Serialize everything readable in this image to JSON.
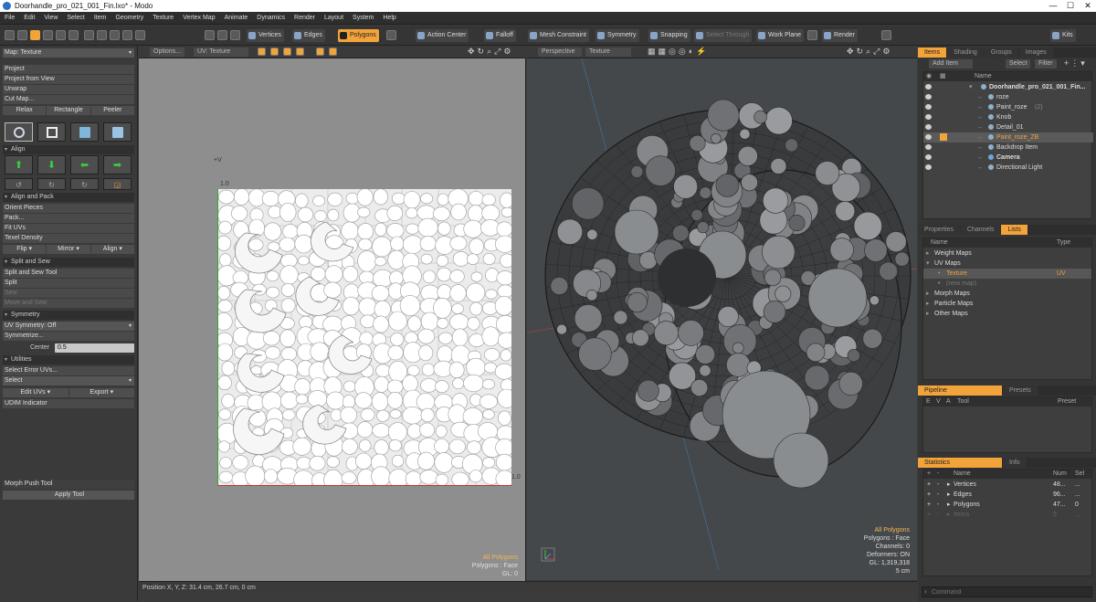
{
  "window": {
    "title": "Doorhandle_pro_021_001_Fin.lxo* - Modo",
    "min": "—",
    "max": "☐",
    "close": "✕"
  },
  "menu": [
    "File",
    "Edit",
    "View",
    "Select",
    "Item",
    "Geometry",
    "Texture",
    "Vertex Map",
    "Animate",
    "Dynamics",
    "Render",
    "Layout",
    "System",
    "Help"
  ],
  "toolbar": {
    "vertices": "Vertices",
    "edges": "Edges",
    "polygons": "Polygons",
    "action_center": "Action Center",
    "falloff": "Falloff",
    "mesh_constraint": "Mesh Constraint",
    "symmetry": "Symmetry",
    "snapping": "Snapping",
    "select_through": "Select Through",
    "work_plane": "Work Plane",
    "render": "Render",
    "kits": "Kits"
  },
  "left": {
    "map_select": "Map: Texture",
    "project": "Project",
    "project_from_view": "Project from View",
    "unwrap": "Unwrap",
    "cut_map": "Cut Map...",
    "relax": "Relax",
    "rectangle": "Rectangle",
    "peeler": "Peeler",
    "align": "Align",
    "align_and_pack": "Align and Pack",
    "orient_pieces": "Orient Pieces",
    "pack": "Pack...",
    "fit_uvs": "Fit UVs",
    "texel_density": "Texel Density",
    "flip": "Flip",
    "mirror": "Mirror",
    "align_btn": "Align",
    "split_and_sew": "Split and Sew",
    "split_and_sew_tool": "Split and Sew Tool",
    "split": "Split",
    "sew": "Sew",
    "move_and_sew": "Move and Sew",
    "symmetry": "Symmetry",
    "uv_symmetry": "UV Symmetry: Off",
    "symmetrize": "Symmetrize...",
    "center_label": "Center",
    "center_value": "0.5",
    "utilities": "Utilities",
    "select_error_uvs": "Select Error UVs...",
    "select": "Select",
    "edit_uvs": "Edit UVs",
    "export": "Export",
    "udim_indicator": "UDIM Indicator",
    "morph_push_tool": "Morph Push Tool",
    "apply_tool": "Apply Tool"
  },
  "uv": {
    "options": "Options...",
    "view_label": "UV: Texture",
    "plus_v": "+V",
    "tick_top": "1.0",
    "tick_right": "1.0",
    "info1": "All Polygons",
    "info2": "Polygons : Face",
    "info3": "GL: 0"
  },
  "view3d": {
    "perspective": "Perspective",
    "texture": "Texture",
    "info": [
      "All Polygons",
      "Polygons : Face",
      "Channels: 0",
      "Deformers: ON",
      "GL: 1,319,318",
      "5 cm"
    ]
  },
  "status": "Position X, Y, Z:  31.4 cm, 26.7 cm, 0 cm",
  "items_panel": {
    "tabs": [
      "Items",
      "Shading",
      "Groups",
      "Images"
    ],
    "add_item": "Add Item",
    "select": "Select",
    "filter": "Filter",
    "col_name": "Name",
    "rows": [
      {
        "label": "Doorhandle_pro_021_001_Fin...",
        "bold": true,
        "indent": 0
      },
      {
        "label": "roze",
        "indent": 1
      },
      {
        "label": "Paint_roze",
        "suffix": "(2)",
        "indent": 1
      },
      {
        "label": "Knob",
        "indent": 1
      },
      {
        "label": "Detail_01",
        "indent": 1
      },
      {
        "label": "Paint_roze_ZB",
        "indent": 1,
        "selected": true
      },
      {
        "label": "Backdrop Item",
        "indent": 1
      },
      {
        "label": "Camera",
        "indent": 1,
        "bold": true
      },
      {
        "label": "Directional Light",
        "indent": 1
      }
    ]
  },
  "lists_panel": {
    "tabs": [
      "Properties",
      "Channels",
      "Lists"
    ],
    "col_name": "Name",
    "col_type": "Type",
    "rows": [
      {
        "label": "Weight Maps"
      },
      {
        "label": "UV Maps",
        "open": true
      },
      {
        "label": "Texture",
        "type": "UV",
        "selected": true
      },
      {
        "label": "(new map)",
        "dim": true
      },
      {
        "label": "Morph Maps"
      },
      {
        "label": "Particle Maps"
      },
      {
        "label": "Other Maps"
      }
    ]
  },
  "pipeline_panel": {
    "tabs": [
      "Pipeline",
      "Presets"
    ],
    "cols": [
      "E",
      "V",
      "A",
      "Tool",
      "Preset"
    ]
  },
  "stats_panel": {
    "tabs": [
      "Statistics",
      "Info"
    ],
    "cols": [
      "Name",
      "Num",
      "Sel"
    ],
    "rows": [
      {
        "label": "Vertices",
        "num": "48...",
        "sel": "..."
      },
      {
        "label": "Edges",
        "num": "96...",
        "sel": "..."
      },
      {
        "label": "Polygons",
        "num": "47...",
        "sel": "0"
      },
      {
        "label": "Items",
        "num": "5",
        "sel": "...",
        "dim": true
      }
    ]
  },
  "command_placeholder": "Command"
}
